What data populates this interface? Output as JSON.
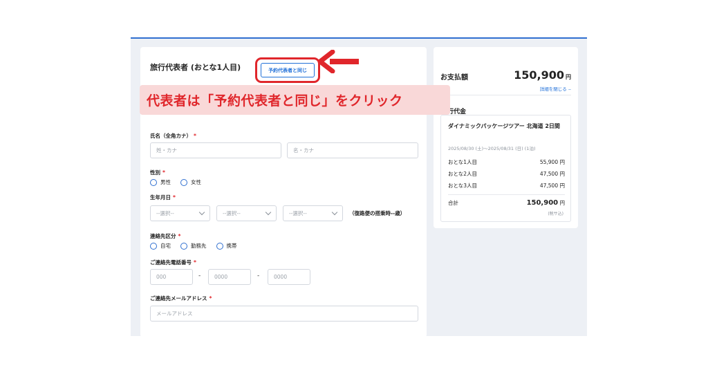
{
  "form": {
    "section_title": "旅行代表者 (おとな1人目)",
    "same_button_label": "予約代表者と同じ",
    "name_label": "氏名（全角カナ）",
    "required_mark": "*",
    "last_name_placeholder": "姓・カナ",
    "first_name_placeholder": "名・カナ",
    "gender_label": "性別",
    "gender_options": [
      "男性",
      "女性"
    ],
    "birth_label": "生年月日",
    "select_placeholder": "--選択--",
    "age_note": "（復路便の搭乗時--歳）",
    "contact_type_label": "連絡先区分",
    "contact_type_options": [
      "自宅",
      "勤務先",
      "携帯"
    ],
    "phone_label": "ご連絡先電話番号",
    "phone_placeholders": [
      "000",
      "0000",
      "0000"
    ],
    "phone_separator": "-",
    "email_label": "ご連絡先メールアドレス",
    "email_placeholder": "メールアドレス"
  },
  "annotation": {
    "text": "代表者は「予約代表者と同じ」をクリック",
    "color": "#e0262b"
  },
  "summary": {
    "title": "お支払額",
    "amount": "150,900",
    "currency": "円",
    "detail_link": "詳細を閉じる ‒",
    "subsection_title": "行代金",
    "tour_name": "ダイナミックパッケージツアー 北海道 2日間",
    "tour_dates": "2025/08/30 (土)～2025/08/31 (日) (1泊)",
    "rows": [
      {
        "label": "おとな1人目",
        "value": "55,900 円"
      },
      {
        "label": "おとな2人目",
        "value": "47,500 円"
      },
      {
        "label": "おとな3人目",
        "value": "47,500 円"
      }
    ],
    "total_label": "合計",
    "total_value": "150,900",
    "total_currency": "円",
    "tax_note": "(税サ込)"
  },
  "colors": {
    "accent": "#1f6fd8",
    "highlight": "#e0262b",
    "annotation_bg": "#f9d8d8",
    "page_bg": "#edf0f5"
  }
}
